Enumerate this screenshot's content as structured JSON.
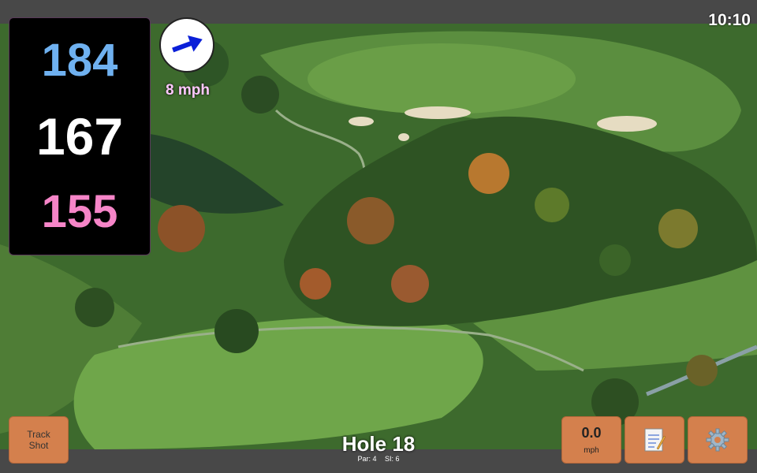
{
  "status": {
    "time": "10:10"
  },
  "yardage": {
    "back": "184",
    "middle": "167",
    "front": "155"
  },
  "wind": {
    "speed_label": "8 mph",
    "arrow_icon": "wind-direction-arrow-icon"
  },
  "hole": {
    "title": "Hole 18",
    "par_label": "Par: 4",
    "si_label": "SI: 6"
  },
  "buttons": {
    "track_shot_line1": "Track",
    "track_shot_line2": "Shot",
    "speed_value": "0.0",
    "speed_unit": "mph",
    "notes_icon": "notepad-icon",
    "settings_icon": "gear-icon"
  },
  "colors": {
    "back_yardage": "#6fb1f0",
    "middle_yardage": "#ffffff",
    "front_yardage": "#f685c8",
    "button": "#d4804d"
  }
}
